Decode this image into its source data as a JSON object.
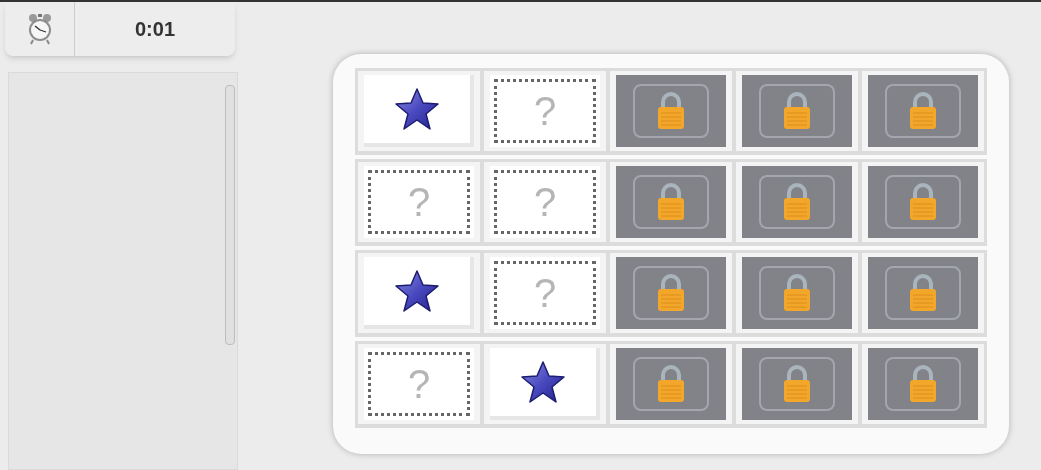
{
  "timer": {
    "time": "0:01"
  },
  "board": {
    "rows": [
      [
        {
          "kind": "star"
        },
        {
          "kind": "question",
          "label": "?"
        },
        {
          "kind": "locked"
        },
        {
          "kind": "locked"
        },
        {
          "kind": "locked"
        }
      ],
      [
        {
          "kind": "question",
          "label": "?"
        },
        {
          "kind": "question",
          "label": "?"
        },
        {
          "kind": "locked"
        },
        {
          "kind": "locked"
        },
        {
          "kind": "locked"
        }
      ],
      [
        {
          "kind": "star"
        },
        {
          "kind": "question",
          "label": "?"
        },
        {
          "kind": "locked"
        },
        {
          "kind": "locked"
        },
        {
          "kind": "locked"
        }
      ],
      [
        {
          "kind": "question",
          "label": "?"
        },
        {
          "kind": "star"
        },
        {
          "kind": "locked"
        },
        {
          "kind": "locked"
        },
        {
          "kind": "locked"
        }
      ]
    ]
  }
}
